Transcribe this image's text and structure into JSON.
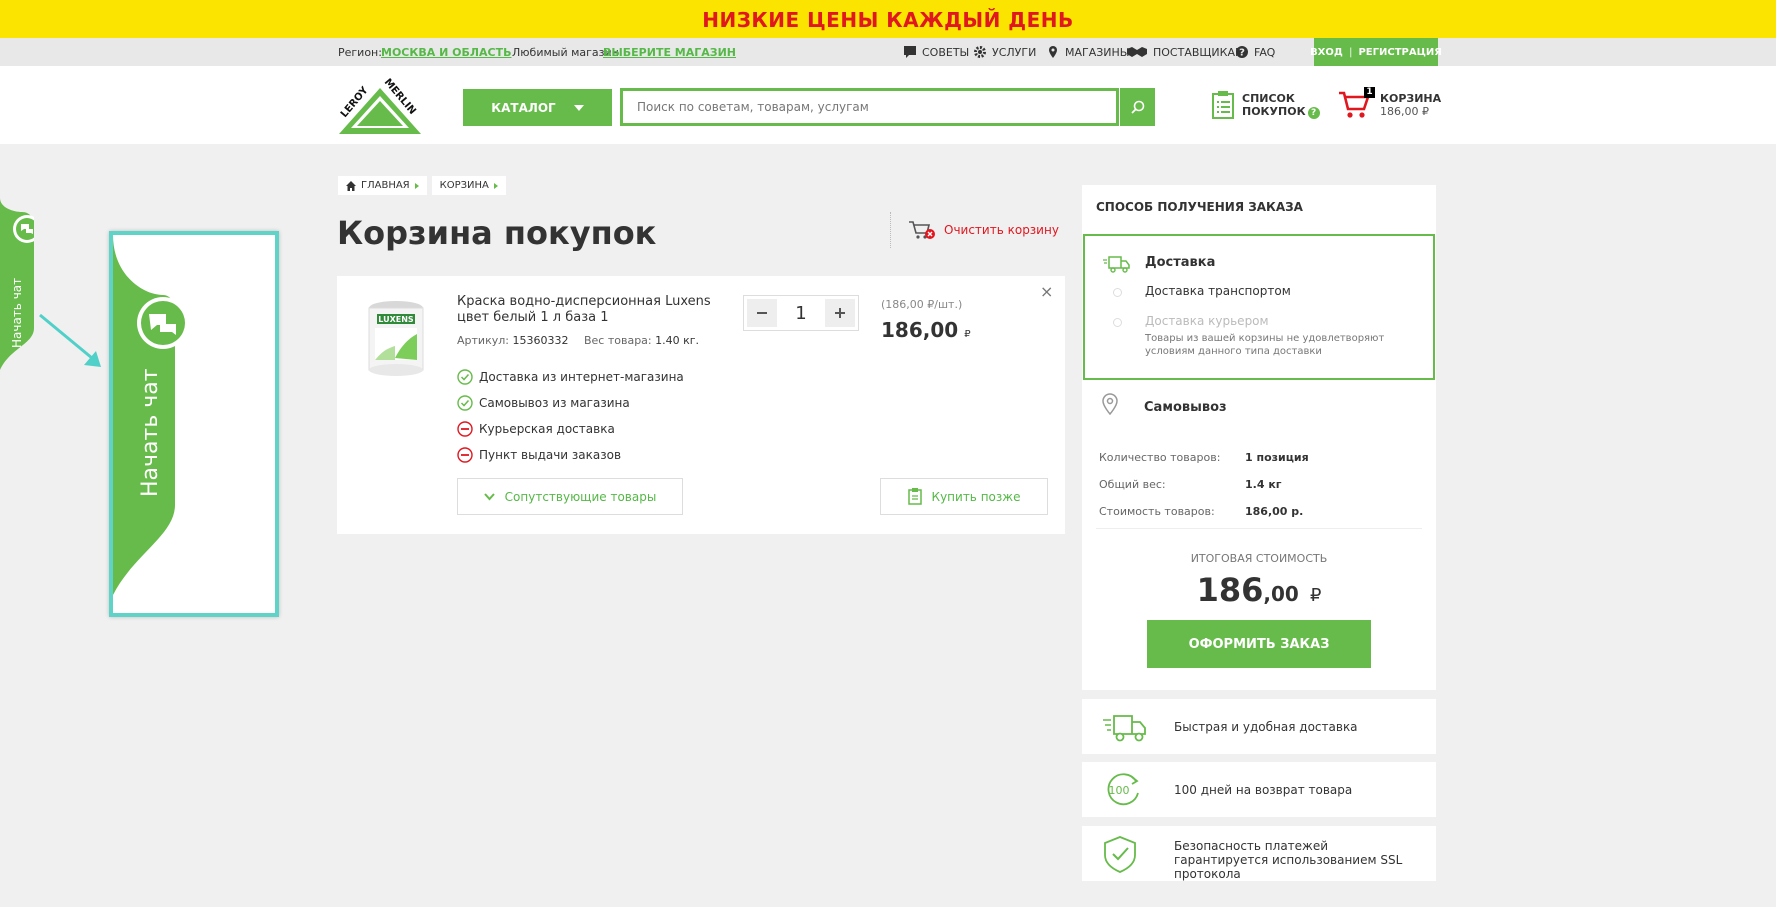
{
  "promo": {
    "text": "НИЗКИЕ ЦЕНЫ КАЖДЫЙ ДЕНЬ"
  },
  "topbar": {
    "region_label": "Регион:",
    "region_value": "МОСКВА И ОБЛАСТЬ",
    "store_label": "Любимый магазин:",
    "store_value": "ВЫБЕРИТЕ МАГАЗИН",
    "nav": [
      "Советы",
      "Услуги",
      "Магазины",
      "Поставщикам",
      "FAQ"
    ],
    "login": "ВХОД",
    "register": "РЕГИСТРАЦИЯ"
  },
  "header": {
    "logo_text_1": "LEROY",
    "logo_text_2": "MERLIN",
    "catalog": "КАТАЛОГ",
    "search_placeholder": "Поиск по советам, товарам, услугам",
    "list_line1": "СПИСОК",
    "list_line2": "ПОКУПОК",
    "list_help": "?",
    "cart_label": "КОРЗИНА",
    "cart_count": "1",
    "cart_total": "186,00 ₽"
  },
  "chat": {
    "label": "Начать чат"
  },
  "breadcrumbs": [
    "ГЛАВНАЯ",
    "КОРЗИНА"
  ],
  "page": {
    "title": "Корзина покупок",
    "clear_cart": "Очистить корзину"
  },
  "product": {
    "name": "Краска водно-дисперсионная Luxens цвет белый 1 л база 1",
    "article_label": "Артикул:",
    "article": "15360332",
    "weight_label": "Вес товара:",
    "weight": "1.40 кг.",
    "options": [
      {
        "label": "Доставка из интернет-магазина",
        "available": true
      },
      {
        "label": "Самовывоз из магазина",
        "available": true
      },
      {
        "label": "Курьерская доставка",
        "available": false
      },
      {
        "label": "Пункт выдачи заказов",
        "available": false
      }
    ],
    "quantity": "1",
    "unit_price": "(186,00 ₽/шт.)",
    "price": "186,00",
    "currency": "₽",
    "remove": "×",
    "related_btn": "Сопутствующие товары",
    "later_btn": "Купить позже"
  },
  "order": {
    "heading": "СПОСОБ ПОЛУЧЕНИЯ ЗАКАЗА",
    "delivery_title": "Доставка",
    "delivery_transport": "Доставка транспортом",
    "delivery_courier": "Доставка курьером",
    "courier_note": "Товары из вашей корзины не удовлетворяют условиям данного типа доставки",
    "pickup": "Самовывоз",
    "summary": [
      {
        "label": "Количество товаров:",
        "value": "1 позиция"
      },
      {
        "label": "Общий вес:",
        "value": "1.4 кг"
      },
      {
        "label": "Стоимость товаров:",
        "value": "186,00 р."
      }
    ],
    "total_label": "Итоговая стоимость",
    "total_int": "186",
    "total_frac": ",00",
    "total_currency": "₽",
    "checkout": "ОФОРМИТЬ ЗАКАЗ"
  },
  "benefits": [
    {
      "text": "Быстрая и удобная доставка",
      "icon": "truck-icon"
    },
    {
      "text": "100 дней на возврат товара",
      "icon": "return-100-icon",
      "badge": "100"
    },
    {
      "text": "Безопасность платежей гарантируется использованием SSL протокола",
      "icon": "shield-check-icon"
    }
  ],
  "colors": {
    "green": "#66bb4a",
    "yellow": "#fbe400",
    "red": "#e0171f",
    "teal": "#5fd3c7"
  }
}
